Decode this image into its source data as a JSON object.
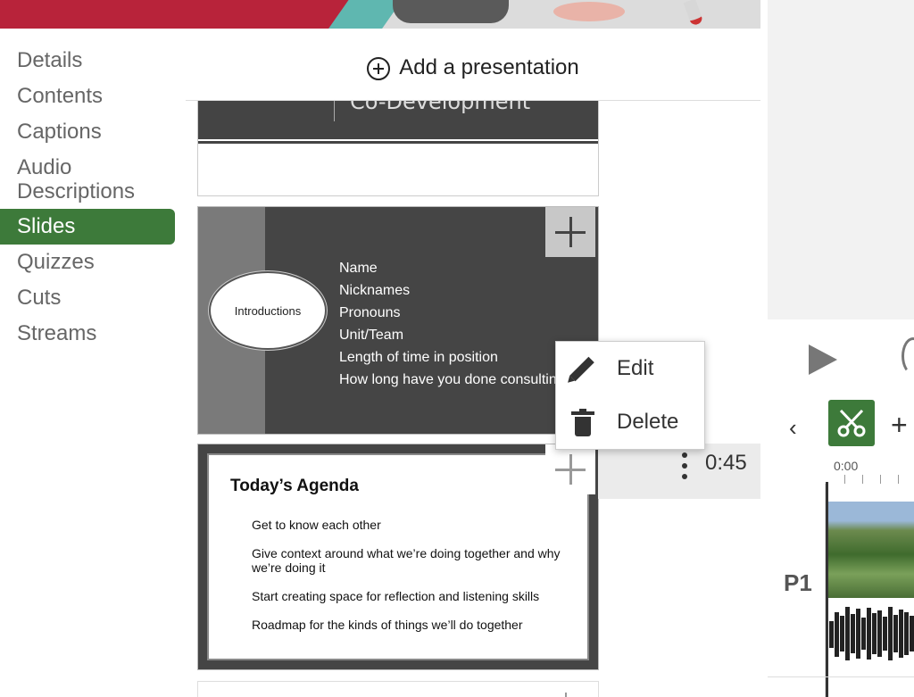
{
  "nav": {
    "items": [
      {
        "label": "Details",
        "active": false
      },
      {
        "label": "Contents",
        "active": false
      },
      {
        "label": "Captions",
        "active": false
      },
      {
        "label": "Audio Descriptions",
        "active": false
      },
      {
        "label": "Slides",
        "active": true
      },
      {
        "label": "Quizzes",
        "active": false
      },
      {
        "label": "Cuts",
        "active": false
      },
      {
        "label": "Streams",
        "active": false
      }
    ]
  },
  "add_presentation": {
    "label": "Add a presentation",
    "icon": "circle-plus-icon"
  },
  "slides": {
    "slide1": {
      "title_fragment": "Co-Development"
    },
    "slide2": {
      "oval_text": "Introductions",
      "bullets": [
        "Name",
        "Nicknames",
        "Pronouns",
        "Unit/Team",
        "Length of time in position",
        "How long have you done consulting"
      ]
    },
    "slide3": {
      "title": "Today’s Agenda",
      "items": [
        "Get to know each other",
        "Give context around what we’re doing together and why we’re doing it",
        "Start creating space for reflection and listening skills",
        "Roadmap for the kinds of things we’ll do together"
      ]
    },
    "selected_time": "0:45"
  },
  "context_menu": {
    "edit_label": "Edit",
    "delete_label": "Delete"
  },
  "editor": {
    "ruler_start": "0:00",
    "track_label": "P1",
    "accent_color": "#3d7a3a"
  }
}
